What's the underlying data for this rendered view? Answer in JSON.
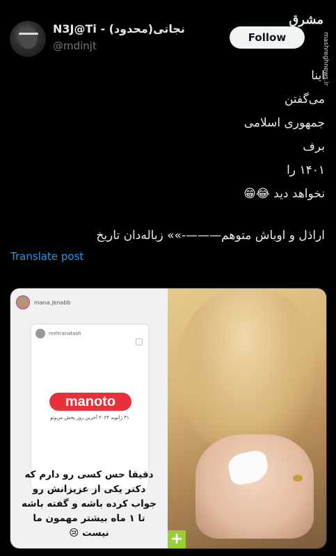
{
  "tweet": {
    "author": {
      "display_name": "N3J@Ti - (نجاتی(محدود",
      "handle": "@mdinjt"
    },
    "follow_label": "Follow",
    "text_lines": [
      "اینا",
      "می‌گفتن",
      "جمهوری اسلامی",
      "برف",
      "۱۴۰۱ را",
      "نخواهد دید 😂😁"
    ],
    "second_paragraph": "اراذل و اوباش متوهم———-»» زباله‌دان تاریخ",
    "translate_label": "Translate post"
  },
  "watermark": {
    "brand": "مشرق",
    "url": "mashreghnews.ir"
  },
  "media": {
    "story_user": "mana.jenabb",
    "card_user": "mehranatash",
    "logo_text": "manoto",
    "logo_caption": "۳۱ ژانویه ۲۰۲۴ آخرین روز پخش من‌وتو",
    "story_text_lines": [
      "دقیقا حس کسی رو دارم که",
      "دکتر یکی از عزیزانش رو",
      "جواب کرده باشه و گفته باشه",
      "تا ۱ ماه بیشتر مهمون ما",
      "نیست 😢"
    ],
    "plus_label": "+"
  },
  "colors": {
    "background": "#000000",
    "link": "#1d9bf0",
    "manoto_red": "#e8303a"
  }
}
